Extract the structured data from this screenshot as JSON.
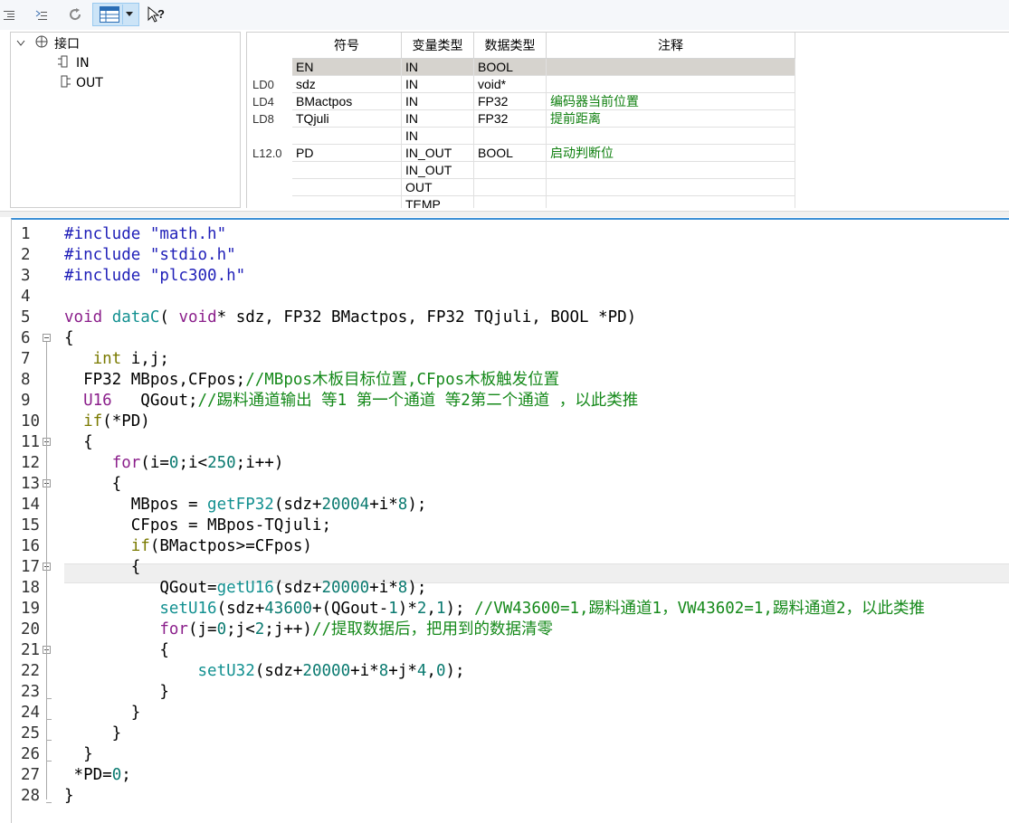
{
  "toolbar": {
    "icons": [
      "indent-icon",
      "outdent-icon",
      "refresh-icon",
      "table-view-icon",
      "dropdown-icon",
      "help-cursor-icon"
    ]
  },
  "tree": {
    "root": "接口",
    "children": [
      "IN",
      "OUT"
    ]
  },
  "interface": {
    "headers": [
      "符号",
      "变量类型",
      "数据类型",
      "注释"
    ],
    "rows": [
      {
        "addr": "",
        "sym": "EN",
        "var": "IN",
        "dtype": "BOOL",
        "comment": ""
      },
      {
        "addr": "LD0",
        "sym": "sdz",
        "var": "IN",
        "dtype": "void*",
        "comment": ""
      },
      {
        "addr": "LD4",
        "sym": "BMactpos",
        "var": "IN",
        "dtype": "FP32",
        "comment": "编码器当前位置"
      },
      {
        "addr": "LD8",
        "sym": "TQjuli",
        "var": "IN",
        "dtype": "FP32",
        "comment": "提前距离"
      },
      {
        "addr": "",
        "sym": "",
        "var": "IN",
        "dtype": "",
        "comment": ""
      },
      {
        "addr": "L12.0",
        "sym": "PD",
        "var": "IN_OUT",
        "dtype": "BOOL",
        "comment": "启动判断位"
      },
      {
        "addr": "",
        "sym": "",
        "var": "IN_OUT",
        "dtype": "",
        "comment": ""
      },
      {
        "addr": "",
        "sym": "",
        "var": "OUT",
        "dtype": "",
        "comment": ""
      },
      {
        "addr": "",
        "sym": "",
        "var": "TEMP",
        "dtype": "",
        "comment": ""
      }
    ]
  },
  "editor": {
    "line_numbers": [
      "1",
      "2",
      "3",
      "4",
      "5",
      "6",
      "7",
      "8",
      "9",
      "10",
      "11",
      "12",
      "13",
      "14",
      "15",
      "16",
      "17",
      "18",
      "19",
      "20",
      "21",
      "22",
      "23",
      "24",
      "25",
      "26",
      "27",
      "28"
    ],
    "lines": [
      [
        {
          "c": "k",
          "t": "#include "
        },
        {
          "c": "s",
          "t": "\"math.h\""
        }
      ],
      [
        {
          "c": "k",
          "t": "#include "
        },
        {
          "c": "s",
          "t": "\"stdio.h\""
        }
      ],
      [
        {
          "c": "k",
          "t": "#include "
        },
        {
          "c": "s",
          "t": "\"plc300.h\""
        }
      ],
      [],
      [
        {
          "c": "t",
          "t": "void"
        },
        {
          "c": "",
          "t": " "
        },
        {
          "c": "f",
          "t": "dataC"
        },
        {
          "c": "",
          "t": "( "
        },
        {
          "c": "t",
          "t": "void"
        },
        {
          "c": "",
          "t": "* sdz, FP32 BMactpos, FP32 TQjuli, BOOL *PD)"
        }
      ],
      [
        {
          "c": "",
          "t": "{"
        }
      ],
      [
        {
          "c": "",
          "t": "   "
        },
        {
          "c": "y",
          "t": "int"
        },
        {
          "c": "",
          "t": " i,j;"
        }
      ],
      [
        {
          "c": "",
          "t": "  FP32 MBpos,CFpos;"
        },
        {
          "c": "cmt",
          "t": "//MBpos木板目标位置,CFpos木板触发位置"
        }
      ],
      [
        {
          "c": "",
          "t": "  "
        },
        {
          "c": "t",
          "t": "U16"
        },
        {
          "c": "",
          "t": "   QGout;"
        },
        {
          "c": "cmt",
          "t": "//踢料通道输出 等1 第一个通道 等2第二个通道 ，以此类推"
        }
      ],
      [
        {
          "c": "",
          "t": "  "
        },
        {
          "c": "y",
          "t": "if"
        },
        {
          "c": "",
          "t": "(*PD)"
        }
      ],
      [
        {
          "c": "",
          "t": "  {"
        }
      ],
      [
        {
          "c": "",
          "t": "     "
        },
        {
          "c": "t",
          "t": "for"
        },
        {
          "c": "",
          "t": "(i="
        },
        {
          "c": "n",
          "t": "0"
        },
        {
          "c": "",
          "t": ";i<"
        },
        {
          "c": "n",
          "t": "250"
        },
        {
          "c": "",
          "t": ";i++)"
        }
      ],
      [
        {
          "c": "",
          "t": "     {"
        }
      ],
      [
        {
          "c": "",
          "t": "       MBpos = "
        },
        {
          "c": "f",
          "t": "getFP32"
        },
        {
          "c": "",
          "t": "(sdz+"
        },
        {
          "c": "n",
          "t": "20004"
        },
        {
          "c": "",
          "t": "+i*"
        },
        {
          "c": "n",
          "t": "8"
        },
        {
          "c": "",
          "t": ");"
        }
      ],
      [
        {
          "c": "",
          "t": "       CFpos = MBpos-TQjuli;"
        }
      ],
      [
        {
          "c": "",
          "t": "       "
        },
        {
          "c": "y",
          "t": "if"
        },
        {
          "c": "",
          "t": "(BMactpos>=CFpos)"
        }
      ],
      [
        {
          "c": "",
          "t": "       {"
        }
      ],
      [
        {
          "c": "",
          "t": "          QGout="
        },
        {
          "c": "f",
          "t": "getU16"
        },
        {
          "c": "",
          "t": "(sdz+"
        },
        {
          "c": "n",
          "t": "20000"
        },
        {
          "c": "",
          "t": "+i*"
        },
        {
          "c": "n",
          "t": "8"
        },
        {
          "c": "",
          "t": ");"
        }
      ],
      [
        {
          "c": "",
          "t": "          "
        },
        {
          "c": "f",
          "t": "setU16"
        },
        {
          "c": "",
          "t": "(sdz+"
        },
        {
          "c": "n",
          "t": "43600"
        },
        {
          "c": "",
          "t": "+(QGout-"
        },
        {
          "c": "n",
          "t": "1"
        },
        {
          "c": "",
          "t": ")*"
        },
        {
          "c": "n",
          "t": "2"
        },
        {
          "c": "",
          "t": ","
        },
        {
          "c": "n",
          "t": "1"
        },
        {
          "c": "",
          "t": "); "
        },
        {
          "c": "cmt",
          "t": "//VW43600=1,踢料通道1，VW43602=1,踢料通道2，以此类推"
        }
      ],
      [
        {
          "c": "",
          "t": "          "
        },
        {
          "c": "t",
          "t": "for"
        },
        {
          "c": "",
          "t": "(j="
        },
        {
          "c": "n",
          "t": "0"
        },
        {
          "c": "",
          "t": ";j<"
        },
        {
          "c": "n",
          "t": "2"
        },
        {
          "c": "",
          "t": ";j++)"
        },
        {
          "c": "cmt",
          "t": "//提取数据后，把用到的数据清零"
        }
      ],
      [
        {
          "c": "",
          "t": "          {"
        }
      ],
      [
        {
          "c": "",
          "t": "              "
        },
        {
          "c": "f",
          "t": "setU32"
        },
        {
          "c": "",
          "t": "(sdz+"
        },
        {
          "c": "n",
          "t": "20000"
        },
        {
          "c": "",
          "t": "+i*"
        },
        {
          "c": "n",
          "t": "8"
        },
        {
          "c": "",
          "t": "+j*"
        },
        {
          "c": "n",
          "t": "4"
        },
        {
          "c": "",
          "t": ","
        },
        {
          "c": "n",
          "t": "0"
        },
        {
          "c": "",
          "t": ");"
        }
      ],
      [
        {
          "c": "",
          "t": "          }"
        }
      ],
      [
        {
          "c": "",
          "t": "       }"
        }
      ],
      [
        {
          "c": "",
          "t": "     }"
        }
      ],
      [
        {
          "c": "",
          "t": "  }"
        }
      ],
      [
        {
          "c": "",
          "t": " *PD="
        },
        {
          "c": "n",
          "t": "0"
        },
        {
          "c": "",
          "t": ";"
        }
      ],
      [
        {
          "c": "",
          "t": "}"
        }
      ]
    ]
  }
}
